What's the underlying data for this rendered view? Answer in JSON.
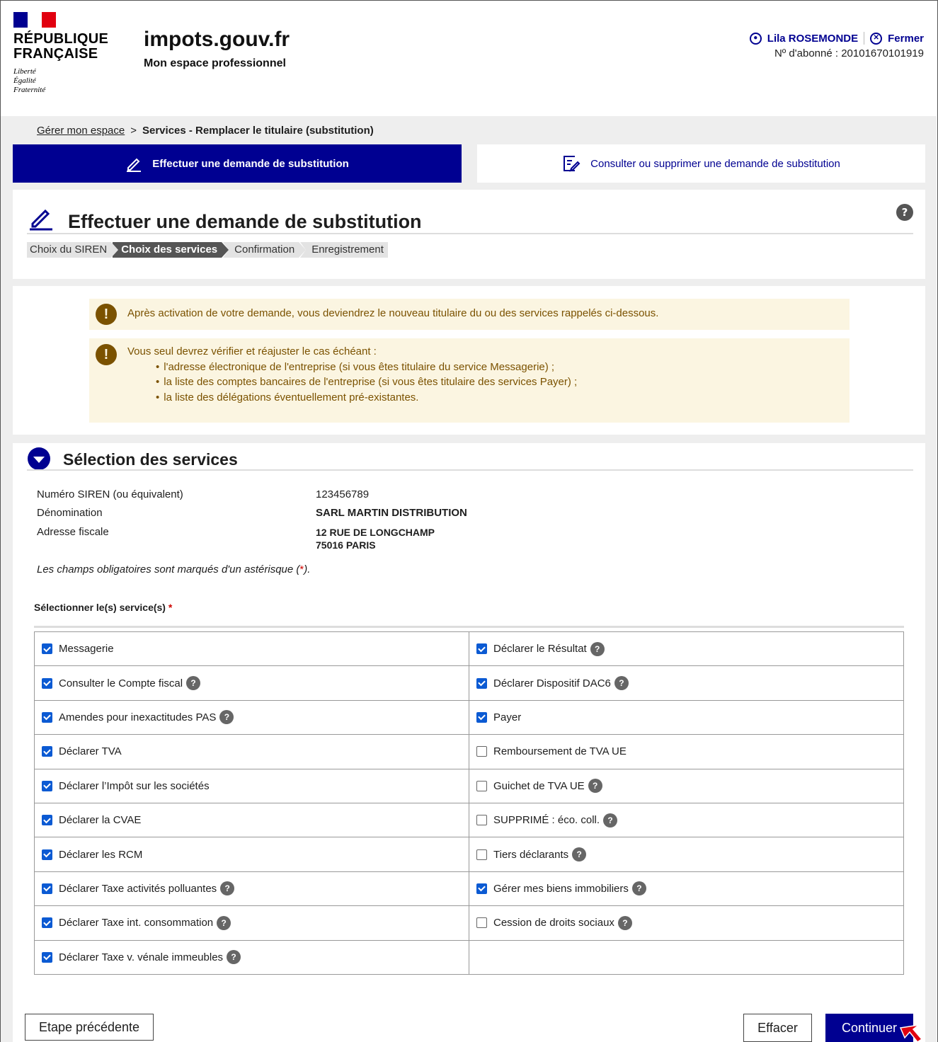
{
  "header": {
    "republic": "RÉPUBLIQUE\nFRANÇAISE",
    "motto": "Liberté\nÉgalité\nFraternité",
    "site_title": "impots.gouv.fr",
    "site_subtitle": "Mon espace professionnel",
    "user_name": "Lila ROSEMONDE",
    "close_label": "Fermer",
    "subscriber": "Nº d'abonné : 20101670101919",
    "flag_colors": [
      "#000091",
      "#ffffff",
      "#e1000f"
    ]
  },
  "breadcrumb": {
    "parent": "Gérer mon espace",
    "separator": ">",
    "current": "Services - Remplacer le titulaire (substitution)"
  },
  "tabs": {
    "active": "Effectuer une demande de substitution",
    "inactive": "Consulter ou supprimer une demande de substitution"
  },
  "page": {
    "title": "Effectuer une demande de substitution",
    "help": "?",
    "steps": [
      "Choix du SIREN",
      "Choix des services",
      "Confirmation",
      "Enregistrement"
    ],
    "active_step": 1
  },
  "alerts": {
    "alert1": "Après activation de votre demande, vous deviendrez le nouveau titulaire du ou des services rappelés ci-dessous.",
    "alert2_intro": "Vous seul devrez vérifier et réajuster le cas échéant :",
    "alert2_items": [
      "l'adresse électronique de l'entreprise (si vous êtes titulaire du service Messagerie) ;",
      "la liste des comptes bancaires de l'entreprise (si vous êtes titulaire des services Payer) ;",
      "la liste des délégations éventuellement pré-existantes."
    ],
    "icon": "!"
  },
  "section": {
    "title": "Sélection des services",
    "siren_label": "Numéro SIREN (ou équivalent)",
    "siren_value": "123456789",
    "denomination_label": "Dénomination",
    "denomination_value": "SARL MARTIN DISTRIBUTION",
    "address_label": "Adresse fiscale",
    "address_value": "12 RUE DE LONGCHAMP\n75016 PARIS",
    "mandatory_pre": "Les champs obligatoires sont marqués d'un astérisque (",
    "mandatory_star": "*",
    "mandatory_post": ").",
    "select_label": "Sélectionner le(s) service(s)",
    "required_star": "*"
  },
  "services": [
    [
      {
        "label": "Messagerie",
        "checked": true,
        "help": false
      },
      {
        "label": "Déclarer le Résultat",
        "checked": true,
        "help": true
      }
    ],
    [
      {
        "label": "Consulter le Compte fiscal",
        "checked": true,
        "help": true
      },
      {
        "label": "Déclarer Dispositif DAC6",
        "checked": true,
        "help": true
      }
    ],
    [
      {
        "label": "Amendes pour inexactitudes PAS",
        "checked": true,
        "help": true
      },
      {
        "label": "Payer",
        "checked": true,
        "help": false
      }
    ],
    [
      {
        "label": "Déclarer TVA",
        "checked": true,
        "help": false
      },
      {
        "label": "Remboursement de TVA UE",
        "checked": false,
        "help": false
      }
    ],
    [
      {
        "label": "Déclarer l’Impôt sur les sociétés",
        "checked": true,
        "help": false
      },
      {
        "label": "Guichet de TVA UE",
        "checked": false,
        "help": true
      }
    ],
    [
      {
        "label": "Déclarer la CVAE",
        "checked": true,
        "help": false
      },
      {
        "label": "SUPPRIMÉ : éco. coll.",
        "checked": false,
        "help": true
      }
    ],
    [
      {
        "label": "Déclarer les RCM",
        "checked": true,
        "help": false
      },
      {
        "label": "Tiers déclarants",
        "checked": false,
        "help": true
      }
    ],
    [
      {
        "label": "Déclarer Taxe activités polluantes",
        "checked": true,
        "help": true
      },
      {
        "label": "Gérer mes biens immobiliers",
        "checked": true,
        "help": true
      }
    ],
    [
      {
        "label": "Déclarer Taxe int. consommation",
        "checked": true,
        "help": true
      },
      {
        "label": "Cession de droits sociaux",
        "checked": false,
        "help": true
      }
    ],
    [
      {
        "label": "Déclarer Taxe v. vénale immeubles",
        "checked": true,
        "help": true
      },
      null
    ]
  ],
  "buttons": {
    "previous": "Etape précédente",
    "clear": "Effacer",
    "continue": "Continuer"
  }
}
